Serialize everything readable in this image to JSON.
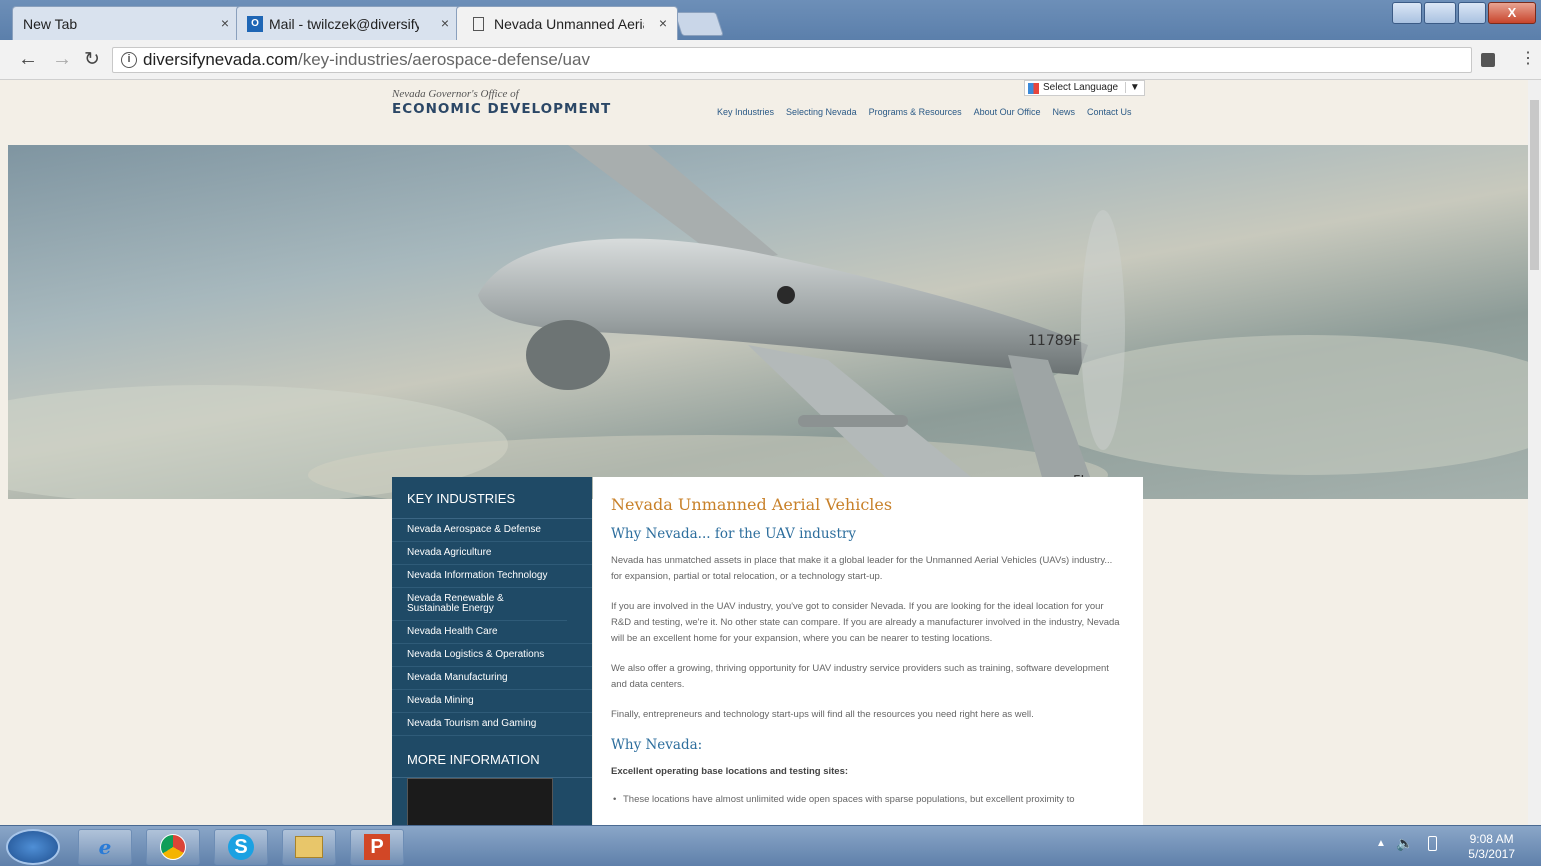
{
  "browser": {
    "tabs": [
      {
        "label": "New Tab"
      },
      {
        "label": "Mail - twilczek@diversify"
      },
      {
        "label": "Nevada Unmanned Aeria"
      }
    ],
    "close_glyph": "×",
    "url_host": "diversifynevada.com",
    "url_path": "/key-industries/aerospace-defense/uav"
  },
  "header": {
    "logo_small": "Nevada Governor's Office of",
    "logo_big": "ECONOMIC DEVELOPMENT",
    "language_select": "Select Language",
    "nav": [
      "Key Industries",
      "Selecting Nevada",
      "Programs & Resources",
      "About Our Office",
      "News",
      "Contact Us"
    ]
  },
  "sidebar": {
    "title": "KEY INDUSTRIES",
    "items": [
      "Nevada Aerospace & Defense",
      "Nevada Agriculture",
      "Nevada Information Technology",
      "Nevada Renewable & Sustainable Energy",
      "Nevada Health Care",
      "Nevada Logistics & Operations",
      "Nevada Manufacturing",
      "Nevada Mining",
      "Nevada Tourism and Gaming"
    ],
    "more_title": "MORE INFORMATION"
  },
  "content": {
    "title": "Nevada Unmanned Aerial Vehicles",
    "subtitle": "Why Nevada... for the UAV industry",
    "p1": "Nevada has unmatched assets in place that make it a global leader for the Unmanned Aerial Vehicles (UAVs) industry... for expansion, partial or total relocation, or a technology start-up.",
    "p2": "If you are involved in the UAV industry, you've got to consider Nevada. If you are looking for the ideal location for your R&D and testing, we're it. No other state can compare. If you are already a manufacturer involved in the industry, Nevada will be an excellent home for your expansion, where you can be nearer to testing locations.",
    "p3": "We also offer a growing, thriving opportunity for UAV industry service providers such as training, software development and data centers.",
    "p4": "Finally, entrepreneurs and technology start-ups will find all the resources you need right here as well.",
    "why_title": "Why Nevada:",
    "bold_line": "Excellent operating base locations and testing sites:",
    "bullet1": "These locations have almost unlimited wide open spaces with sparse populations, but excellent proximity to"
  },
  "hero": {
    "drone_label": "11789F",
    "tail_label": "FL"
  },
  "taskbar": {
    "time": "9:08 AM",
    "date": "5/3/2017"
  }
}
